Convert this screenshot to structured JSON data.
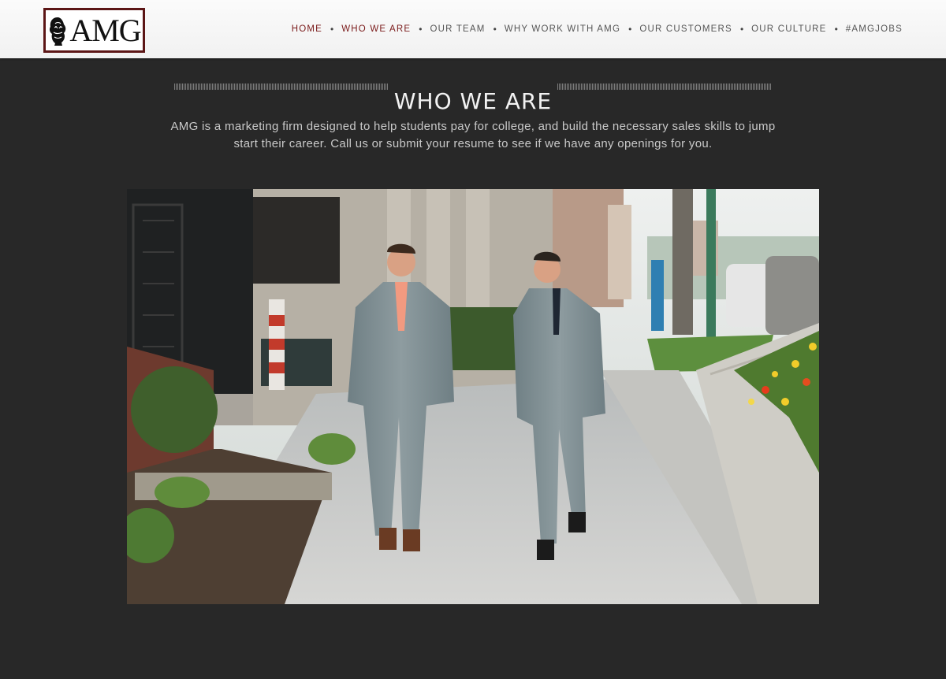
{
  "brand": {
    "logo_text": "AMG"
  },
  "nav": {
    "items": [
      {
        "label": "HOME"
      },
      {
        "label": "WHO WE ARE"
      },
      {
        "label": "OUR TEAM"
      },
      {
        "label": "WHY WORK WITH AMG"
      },
      {
        "label": "OUR CUSTOMERS"
      },
      {
        "label": "OUR CULTURE"
      },
      {
        "label": "#AMGJOBS"
      }
    ],
    "separator": "•"
  },
  "section": {
    "title": "WHO WE ARE",
    "intro": "AMG is a marketing firm designed to help students pay for college, and build the necessary sales skills to jump start their career. Call us or submit your resume to see if we have any openings for you."
  },
  "colors": {
    "page_background": "#282828",
    "header_background": "#f7f7f7",
    "nav_active": "#7a1a1a",
    "logo_border": "#5c1616"
  },
  "icons": {
    "logo_emblem": "lion-icon"
  }
}
